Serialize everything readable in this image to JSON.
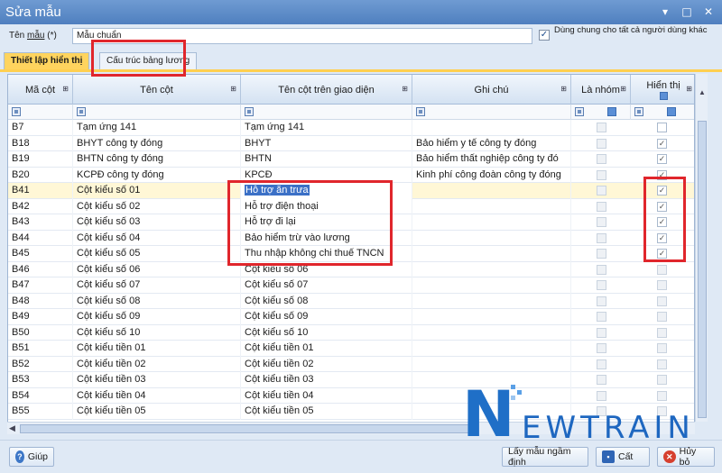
{
  "window": {
    "title": "Sửa mẫu",
    "controls": [
      "▾",
      "□",
      "✕"
    ]
  },
  "name_row": {
    "label_prefix": "Tên ",
    "label_underlined": "mẫu",
    "label_suffix": " (*)",
    "value": "Mẫu chuẩn",
    "share_checked": "✓",
    "share_label": "Dùng chung cho tất cả người dùng khác"
  },
  "tabs": [
    {
      "label": "Thiết lập hiển thị"
    },
    {
      "label": "Cấu trúc bảng lương"
    }
  ],
  "grid": {
    "headers": {
      "ma_cot": "Mã cột",
      "ten_cot": "Tên cột",
      "ten_cot_gd": "Tên cột trên giao diện",
      "ghi_chu": "Ghi chú",
      "la_nhom": "Là nhóm",
      "hien_thi": "Hiển thị"
    },
    "pin_glyph": "⊞",
    "rows": [
      {
        "code": "B7",
        "name": "Tạm ứng 141",
        "ui": "Tạm ứng 141",
        "note": "",
        "shown": ""
      },
      {
        "code": "B18",
        "name": "BHYT công ty đóng",
        "ui": "BHYT",
        "note": "Bảo hiểm y tế công ty đóng",
        "shown": "✓"
      },
      {
        "code": "B19",
        "name": "BHTN công ty đóng",
        "ui": "BHTN",
        "note": "Bảo hiểm thất nghiệp công ty đó",
        "shown": "✓"
      },
      {
        "code": "B20",
        "name": "KCPĐ công ty đóng",
        "ui": "KPCĐ",
        "note": "Kinh phí công đoàn công ty đóng",
        "shown": "✓"
      },
      {
        "code": "B41",
        "name": "Cột kiểu số 01",
        "ui": "Hỗ trợ ăn trưa",
        "note": "",
        "shown": "✓"
      },
      {
        "code": "B42",
        "name": "Cột kiểu số 02",
        "ui": "Hỗ trợ điện thoại",
        "note": "",
        "shown": "✓"
      },
      {
        "code": "B43",
        "name": "Cột kiểu số 03",
        "ui": "Hỗ trợ đi lại",
        "note": "",
        "shown": "✓"
      },
      {
        "code": "B44",
        "name": "Cột kiểu số 04",
        "ui": "Bảo hiểm trừ vào lương",
        "note": "",
        "shown": "✓"
      },
      {
        "code": "B45",
        "name": "Cột kiểu số 05",
        "ui": "Thu nhập không chi thuế TNCN",
        "note": "",
        "shown": "✓"
      },
      {
        "code": "B46",
        "name": "Cột kiểu số 06",
        "ui": "Cột kiểu số 06",
        "note": "",
        "shown": ""
      },
      {
        "code": "B47",
        "name": "Cột kiểu số 07",
        "ui": "Cột kiểu số 07",
        "note": "",
        "shown": ""
      },
      {
        "code": "B48",
        "name": "Cột kiểu số 08",
        "ui": "Cột kiểu số 08",
        "note": "",
        "shown": ""
      },
      {
        "code": "B49",
        "name": "Cột kiểu số 09",
        "ui": "Cột kiểu số 09",
        "note": "",
        "shown": ""
      },
      {
        "code": "B50",
        "name": "Cột kiểu số 10",
        "ui": "Cột kiểu số 10",
        "note": "",
        "shown": ""
      },
      {
        "code": "B51",
        "name": "Cột kiểu tiền 01",
        "ui": "Cột kiểu tiền 01",
        "note": "",
        "shown": ""
      },
      {
        "code": "B52",
        "name": "Cột kiểu tiền 02",
        "ui": "Cột kiểu tiền 02",
        "note": "",
        "shown": ""
      },
      {
        "code": "B53",
        "name": "Cột kiểu tiền 03",
        "ui": "Cột kiểu tiền 03",
        "note": "",
        "shown": ""
      },
      {
        "code": "B54",
        "name": "Cột kiểu tiền 04",
        "ui": "Cột kiểu tiền 04",
        "note": "",
        "shown": ""
      },
      {
        "code": "B55",
        "name": "Cột kiểu tiền 05",
        "ui": "Cột kiểu tiền 05",
        "note": "",
        "shown": ""
      }
    ]
  },
  "buttons": {
    "help": "Giúp",
    "default": "Lấy mẫu ngầm định",
    "save": "Cất",
    "cancel": "Hủy bỏ"
  },
  "watermark": {
    "n": "N",
    "rest": "EWTRAIN"
  },
  "colors": {
    "highlight_red": "#e0262c",
    "active_tab": "#ffd45e",
    "title_blue": "#4f7fbf",
    "brand_blue": "#1f6fc7"
  }
}
